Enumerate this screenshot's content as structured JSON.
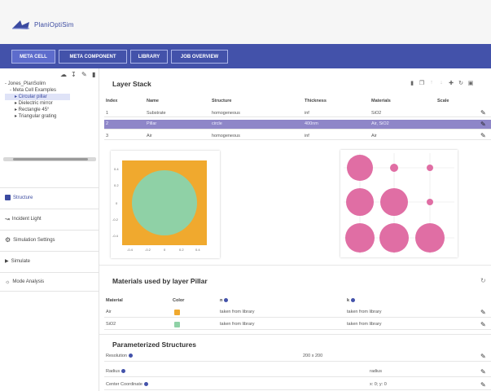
{
  "app": {
    "name": "PlaniOptiSim"
  },
  "nav": {
    "tabs": [
      {
        "label": "META CELL",
        "active": true
      },
      {
        "label": "META COMPONENT",
        "active": false
      },
      {
        "label": "LIBRARY",
        "active": false
      },
      {
        "label": "JOB OVERVIEW",
        "active": false
      }
    ]
  },
  "tree": {
    "items": [
      {
        "label": "- Jones_PlanSolim",
        "indent": 0
      },
      {
        "label": "- Meta Cell Examples",
        "indent": 1
      },
      {
        "label": "▸ Circular pillar",
        "indent": 2,
        "selected": true
      },
      {
        "label": "▸ Dielectric mirror",
        "indent": 2
      },
      {
        "label": "▸ Rectangle 45°",
        "indent": 2
      },
      {
        "label": "▸ Triangular grating",
        "indent": 2
      }
    ]
  },
  "sidebar_menu": [
    {
      "label": "Structure",
      "active": true,
      "icon": "structure-icon"
    },
    {
      "label": "Incident Light",
      "active": false,
      "icon": "light-icon"
    },
    {
      "label": "Simulation Settings",
      "active": false,
      "icon": "settings-gear-icon"
    },
    {
      "label": "Simulate",
      "active": false,
      "icon": "play-icon"
    },
    {
      "label": "Mode Analysis",
      "active": false,
      "icon": "mode-analysis-icon"
    }
  ],
  "layer_stack": {
    "title": "Layer Stack",
    "columns": [
      "Index",
      "Name",
      "Structure",
      "Thickness",
      "Materials",
      "Scale"
    ],
    "rows": [
      [
        "1",
        "Substrate",
        "homogeneous",
        "inf",
        "SiO2",
        ""
      ],
      [
        "2",
        "Pillar",
        "circle",
        "400nm",
        "Air, SiO2",
        ""
      ],
      [
        "3",
        "Air",
        "homogeneous",
        "inf",
        "Air",
        ""
      ]
    ],
    "highlighted_row": 2
  },
  "plots": {
    "structure_plot": {
      "y_ticks": [
        "0.4",
        "0.2",
        "0",
        "-0.2",
        "-0.4"
      ],
      "x_ticks": [
        "-0.4",
        "-0.2",
        "0",
        "0.2",
        "0.4"
      ],
      "outer_color": "#f0a92e",
      "inner_color": "#8fd1a6"
    },
    "library_plot": {
      "circle_color": "#e06ea4"
    }
  },
  "materials": {
    "title": "Materials used by layer Pillar",
    "columns": [
      "Material",
      "Color",
      "n",
      "k"
    ],
    "rows": [
      {
        "material": "Air",
        "color": "#f0a92e",
        "n": "taken from library",
        "k": "taken from library"
      },
      {
        "material": "SiO2",
        "color": "#8fd1a6",
        "n": "taken from library",
        "k": "taken from library"
      }
    ]
  },
  "parameterized": {
    "title": "Parameterized Structures",
    "rows": [
      {
        "label": "Resolution",
        "value": "200 x 200"
      },
      {
        "label": "Radius",
        "value": "radius"
      },
      {
        "label": "Center Coordinate",
        "value": "x: 0; y: 0"
      }
    ]
  }
}
